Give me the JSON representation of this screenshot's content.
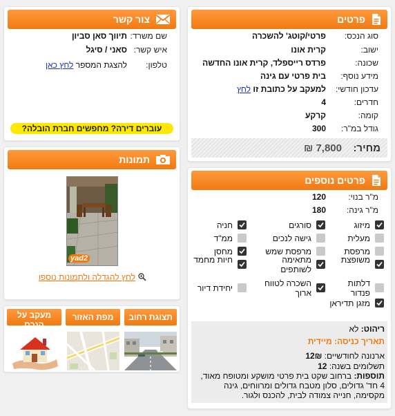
{
  "colors": {
    "accent": "#f07a12",
    "link": "#1a37b8",
    "highlight": "#ffe800",
    "date_orange": "#f07a12"
  },
  "details": {
    "title": "פרטים",
    "icon": "document-icon",
    "rows": [
      {
        "label": "סוג הנכס:",
        "value": "פרטי/קוטג' להשכרה"
      },
      {
        "label": "ישוב:",
        "value": "קרית אונו"
      },
      {
        "label": "שכונה:",
        "value": "פרדס רייספלד, קרית אונו החדשה"
      },
      {
        "label": "מידע נוסף:",
        "value": "בית פרטי עם גינה"
      },
      {
        "label": "עדכון חודשי:",
        "value": "למעקב על כתובת זו",
        "link": "לחץ"
      },
      {
        "label": "חדרים:",
        "value": "4"
      },
      {
        "label": "קומה:",
        "value": "קרקע"
      },
      {
        "label": "גודל במ\"ר:",
        "value": "300"
      }
    ],
    "price_label": "מחיר:",
    "price_value": "7,800 ₪"
  },
  "more": {
    "title": "פרטים נוספים",
    "icon": "document-icon",
    "built_label": "מ\"ר בנוי:",
    "built_value": "120",
    "garden_label": "מ\"ר גינה:",
    "garden_value": "180",
    "features": [
      {
        "label": "מיזוג",
        "checked": true
      },
      {
        "label": "סורגים",
        "checked": true
      },
      {
        "label": "חניה",
        "checked": true
      },
      {
        "label": "מעלית",
        "checked": false
      },
      {
        "label": "גישה לנכים",
        "checked": false
      },
      {
        "label": "ממ\"ד",
        "checked": false
      },
      {
        "label": "מרפסת",
        "checked": false
      },
      {
        "label": "מרפסת שמש",
        "checked": false
      },
      {
        "label": "מחסן",
        "checked": true
      },
      {
        "label": "משופצת",
        "checked": true
      },
      {
        "label": "מתאימה לשותפים",
        "checked": true
      },
      {
        "label": "חיות מחמד",
        "checked": true
      },
      {
        "label": "דלתות פנדור",
        "checked": false
      },
      {
        "label": "השכרה לטווח ארוך",
        "checked": true
      },
      {
        "label": "יחידת דיור",
        "checked": false
      },
      {
        "label": "מזגן תדיראן",
        "checked": true
      }
    ],
    "furniture_label": "ריהוט:",
    "furniture_value": "לא",
    "entry_label": "תאריך כניסה:",
    "entry_value": "מיידית",
    "arnona_label": "ארנונה לחודשיים:",
    "arnona_value": "12₪",
    "payments_label": "תשלומים בשנה:",
    "payments_value": "12",
    "extras_label": "תוספות:",
    "extras_text": "ברחוב שקט בית פרטי מושקע ומטופח מאוד, 4 חד' גדולים, סלון מטבח גדולים ומרווחים, גינה מקסימה, חנייה צמודה לבית, להכנס ולגור."
  },
  "contact": {
    "title": "צור קשר",
    "icon": "envelope-icon",
    "advertiser_label": "שם משרד:",
    "advertiser_value": "תיווך סאן סביון",
    "agent_label": "איש קשר:",
    "agent_value": "סאני / סיגל",
    "phone_label": "טלפון:",
    "phone_text": "להצגת המספר",
    "phone_link": "לחץ כאן",
    "banner": "עוברים דירה? מחפשים חברת הובלה?"
  },
  "photos": {
    "title": "תמונות",
    "icon": "camera-icon",
    "watermark": "yad2",
    "enlarge_link": "לחץ להגדלה ולתמונות נוספו"
  },
  "tabs": [
    {
      "label": "תצוגת רחוב"
    },
    {
      "label": "מפת האזור"
    },
    {
      "label": "מעקב על הנכס"
    }
  ]
}
